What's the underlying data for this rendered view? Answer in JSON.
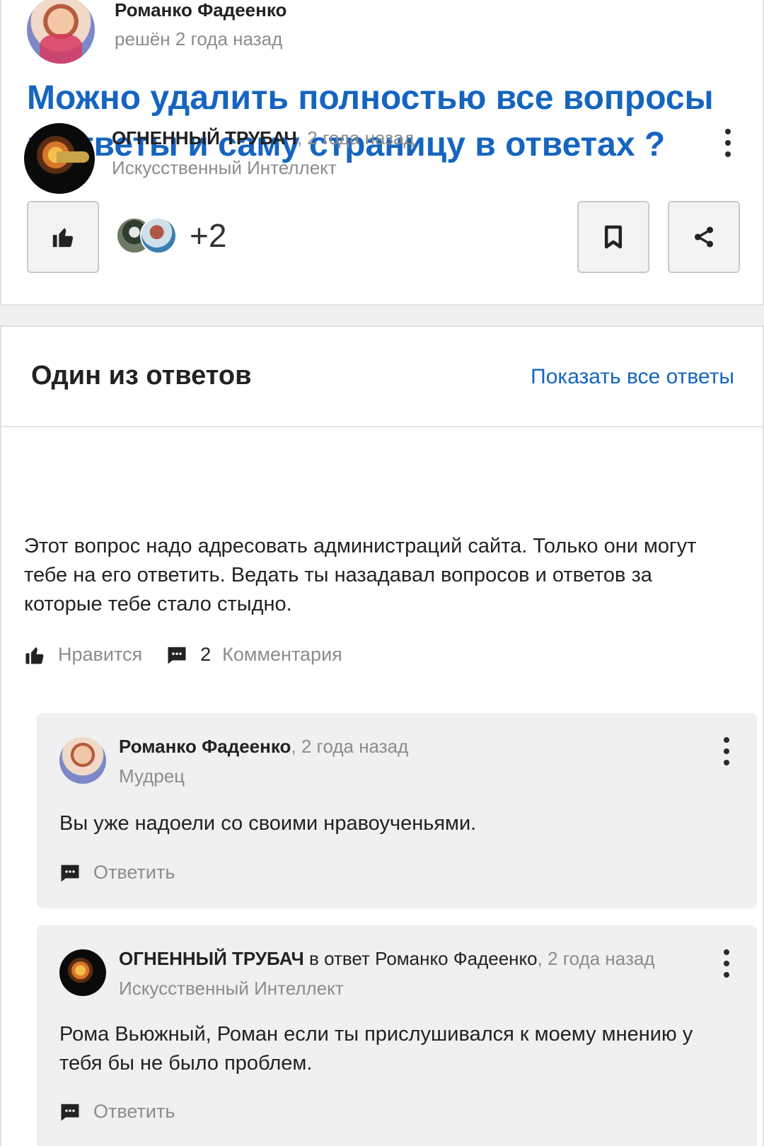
{
  "question": {
    "author_name": "Романко Фадеенко",
    "status": "решён 2 года назад",
    "title": "Можно удалить полностью все вопросы и ответы и саму страницу в ответах ?",
    "likers_count": "+2"
  },
  "answers": {
    "header_title": "Один из ответов",
    "show_all_label": "Показать все ответы"
  },
  "answer": {
    "author_name": "ОГНЕННЫЙ ТРУБАЧ",
    "time": ", 2 года назад",
    "rank": "Искусственный Интеллект",
    "text": "Этот вопрос надо адресовать администраций сайта. Только они могут тебе на его ответить. Ведать ты назадавал вопросов и ответов за которые тебе стало стыдно.",
    "like_label": "Нравится",
    "comments_count": "2",
    "comments_label": "Комментария"
  },
  "comments": [
    {
      "author_name": "Романко Фадеенко",
      "reply_to": "",
      "time": ", 2 года назад",
      "rank": "Мудрец",
      "text": "Вы уже надоели со своими нравоученьями.",
      "reply_label": "Ответить"
    },
    {
      "author_name": "ОГНЕННЫЙ ТРУБАЧ",
      "reply_to": " в ответ Романко Фадеенко",
      "time": ", 2 года назад",
      "rank": "Искусственный Интеллект",
      "text": "Рома Вьюжный, Роман если ты прислушивался к моему мнению у тебя бы не было проблем.",
      "reply_label": "Ответить"
    }
  ],
  "icons": {
    "like": "thumbs-up-icon",
    "bookmark": "bookmark-icon",
    "share": "share-icon",
    "comment": "comment-icon",
    "more": "more-vertical-icon"
  },
  "colors": {
    "link": "#1565c0",
    "muted": "#8c8c8c",
    "comment_bg": "#f0f0f2"
  }
}
